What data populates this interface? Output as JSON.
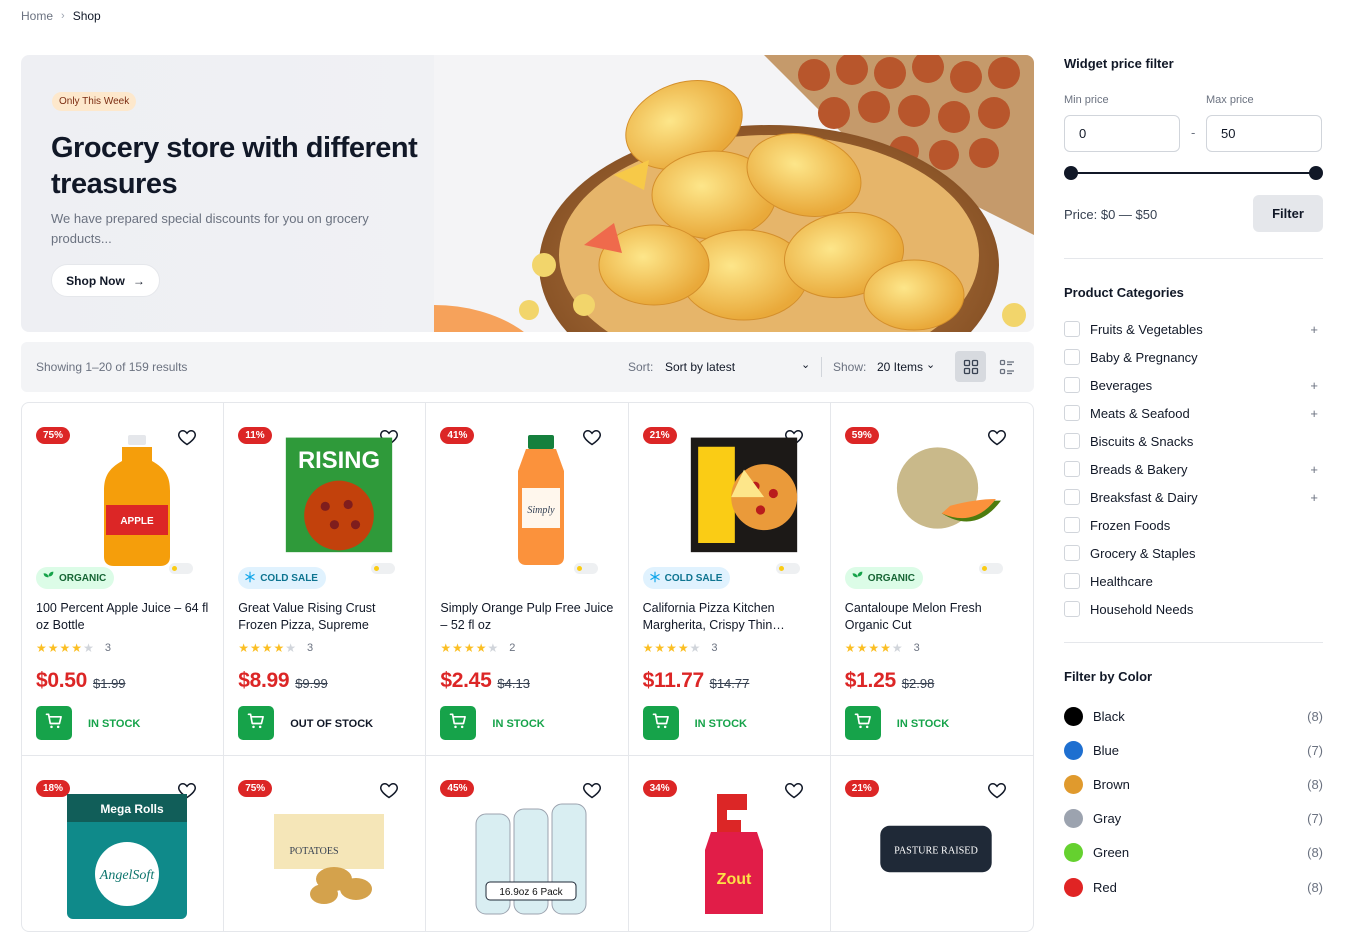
{
  "breadcrumb": {
    "home": "Home",
    "current": "Shop"
  },
  "hero": {
    "badge": "Only This Week",
    "title": "Grocery store with different treasures",
    "subtitle": "We have prepared special discounts for you on grocery products...",
    "button": "Shop Now"
  },
  "toolbar": {
    "results": "Showing 1–20 of 159 results",
    "sort_label": "Sort:",
    "sort_value": "Sort by latest",
    "show_label": "Show:",
    "show_value": "20 Items"
  },
  "products": [
    {
      "discount": "75%",
      "tag": "ORGANIC",
      "tag_type": "organic",
      "name": "100 Percent Apple Juice – 64 fl oz Bottle",
      "rating": 4,
      "reviews": "3",
      "price": "$0.50",
      "old_price": "$1.99",
      "stock": "IN STOCK",
      "in_stock": true,
      "icon": "apple-juice-bottle"
    },
    {
      "discount": "11%",
      "tag": "COLD SALE",
      "tag_type": "cold",
      "name": "Great Value Rising Crust Frozen Pizza, Supreme",
      "rating": 4,
      "reviews": "3",
      "price": "$8.99",
      "old_price": "$9.99",
      "stock": "OUT OF STOCK",
      "in_stock": false,
      "icon": "pizza-box"
    },
    {
      "discount": "41%",
      "tag": "",
      "tag_type": "",
      "name": "Simply Orange Pulp Free Juice – 52 fl oz",
      "rating": 4,
      "reviews": "2",
      "price": "$2.45",
      "old_price": "$4.13",
      "stock": "IN STOCK",
      "in_stock": true,
      "icon": "orange-juice-bottle"
    },
    {
      "discount": "21%",
      "tag": "COLD SALE",
      "tag_type": "cold",
      "name": "California Pizza Kitchen Margherita, Crispy Thin…",
      "rating": 4,
      "reviews": "3",
      "price": "$11.77",
      "old_price": "$14.77",
      "stock": "IN STOCK",
      "in_stock": true,
      "icon": "pizza-box-dark"
    },
    {
      "discount": "59%",
      "tag": "ORGANIC",
      "tag_type": "organic",
      "name": "Cantaloupe Melon Fresh Organic Cut",
      "rating": 4,
      "reviews": "3",
      "price": "$1.25",
      "old_price": "$2.98",
      "stock": "IN STOCK",
      "in_stock": true,
      "icon": "melon"
    },
    {
      "discount": "18%",
      "icon": "toilet-paper-pack"
    },
    {
      "discount": "75%",
      "icon": "potatoes-bag"
    },
    {
      "discount": "45%",
      "icon": "water-bottles-pack"
    },
    {
      "discount": "34%",
      "icon": "spray-bottle"
    },
    {
      "discount": "21%",
      "icon": "egg-carton"
    }
  ],
  "price_filter": {
    "title": "Widget price filter",
    "min_label": "Min price",
    "max_label": "Max price",
    "min_value": "0",
    "max_value": "50",
    "dash": "-",
    "price_text": "Price: $0 — $50",
    "button": "Filter"
  },
  "categories": {
    "title": "Product Categories",
    "items": [
      {
        "label": "Fruits & Vegetables",
        "plus": "+"
      },
      {
        "label": "Baby & Pregnancy",
        "plus": ""
      },
      {
        "label": "Beverages",
        "plus": "+"
      },
      {
        "label": "Meats & Seafood",
        "plus": "+"
      },
      {
        "label": "Biscuits & Snacks",
        "plus": ""
      },
      {
        "label": "Breads & Bakery",
        "plus": "+"
      },
      {
        "label": "Breaksfast & Dairy",
        "plus": "+"
      },
      {
        "label": "Frozen Foods",
        "plus": ""
      },
      {
        "label": "Grocery & Staples",
        "plus": ""
      },
      {
        "label": "Healthcare",
        "plus": ""
      },
      {
        "label": "Household Needs",
        "plus": ""
      }
    ]
  },
  "colors": {
    "title": "Filter by Color",
    "items": [
      {
        "label": "Black",
        "count": "(8)",
        "hex": "#000000"
      },
      {
        "label": "Blue",
        "count": "(7)",
        "hex": "#1e6fd0"
      },
      {
        "label": "Brown",
        "count": "(8)",
        "hex": "#e09a2d"
      },
      {
        "label": "Gray",
        "count": "(7)",
        "hex": "#9ca3af"
      },
      {
        "label": "Green",
        "count": "(8)",
        "hex": "#65d12f"
      },
      {
        "label": "Red",
        "count": "(8)",
        "hex": "#e02424"
      }
    ]
  },
  "theme": {
    "accent": "#16a34a",
    "sale": "#dc2626"
  }
}
